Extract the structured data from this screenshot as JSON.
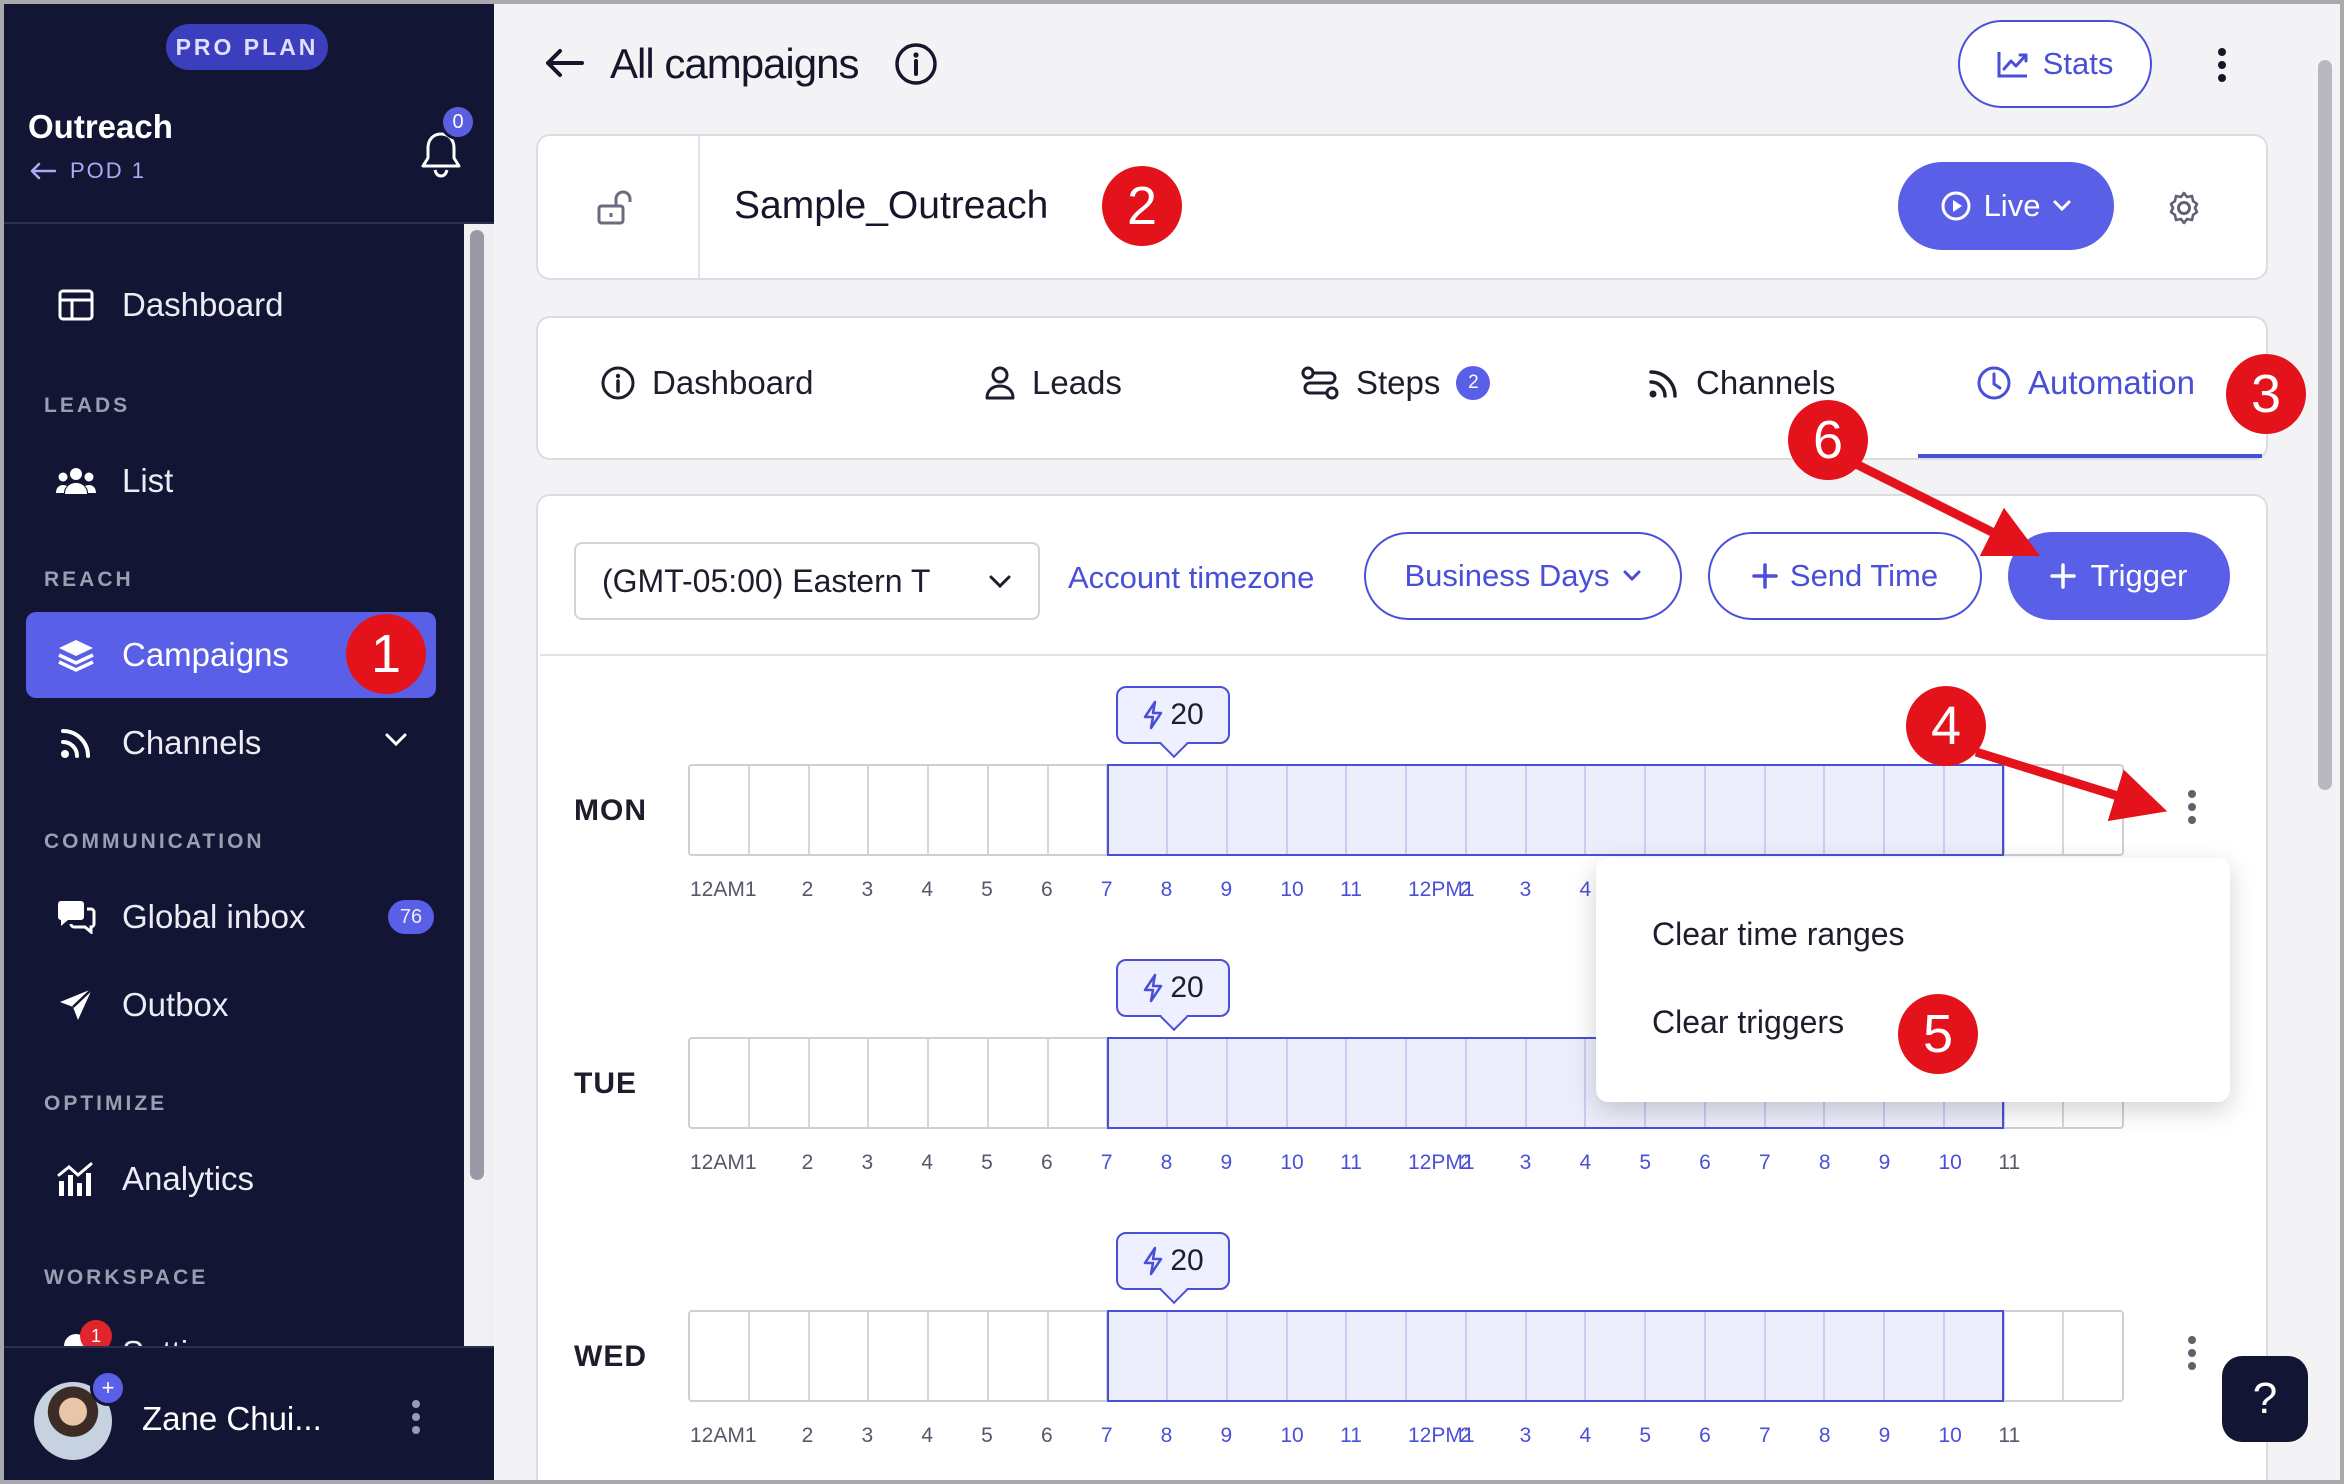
{
  "sidebar": {
    "plan_badge": "PRO PLAN",
    "app_name": "Outreach",
    "pod_label": "POD 1",
    "notification_count": "0",
    "sections": {
      "leads": "LEADS",
      "reach": "REACH",
      "communication": "COMMUNICATION",
      "optimize": "OPTIMIZE",
      "workspace": "WORKSPACE"
    },
    "items": {
      "dashboard": "Dashboard",
      "list": "List",
      "campaigns": "Campaigns",
      "channels": "Channels",
      "global_inbox": "Global inbox",
      "global_inbox_count": "76",
      "outbox": "Outbox",
      "analytics": "Analytics",
      "settings": "Settings",
      "settings_alert": "1"
    },
    "user_name": "Zane Chui...",
    "icons": [
      "dashboard-icon",
      "users-icon",
      "layers-icon",
      "rss-icon",
      "chat-icon",
      "send-icon",
      "analytics-icon",
      "gear-icon"
    ]
  },
  "header": {
    "title": "All campaigns",
    "stats_label": "Stats"
  },
  "campaign": {
    "name": "Sample_Outreach",
    "status_label": "Live"
  },
  "tabs": [
    {
      "label": "Dashboard"
    },
    {
      "label": "Leads"
    },
    {
      "label": "Steps",
      "badge": "2"
    },
    {
      "label": "Channels"
    },
    {
      "label": "Automation",
      "active": true
    }
  ],
  "toolbar": {
    "timezone_value": "(GMT-05:00) Eastern T",
    "account_timezone_link": "Account timezone",
    "business_days_label": "Business Days",
    "send_time_label": "Send Time",
    "trigger_label": "Trigger"
  },
  "schedule": {
    "tick_labels": [
      "12AM1",
      "2",
      "3",
      "4",
      "5",
      "6",
      "7",
      "8",
      "9",
      "10",
      "11",
      "12PM1",
      "2",
      "3",
      "4",
      "5",
      "6",
      "7",
      "8",
      "9",
      "10",
      "11"
    ],
    "active_hours": {
      "start": 7,
      "end": 22
    },
    "days": [
      {
        "label": "MON",
        "trigger_count": "20"
      },
      {
        "label": "TUE",
        "trigger_count": "20"
      },
      {
        "label": "WED",
        "trigger_count": "20"
      }
    ]
  },
  "menu": {
    "items": [
      "Clear time ranges",
      "Clear triggers"
    ]
  },
  "help_label": "?",
  "annotations": [
    "1",
    "2",
    "3",
    "4",
    "5",
    "6"
  ],
  "colors": {
    "sidebar_bg": "#121533",
    "accent": "#5a5fe8",
    "accent_text": "#4a4fd8",
    "annotation_red": "#e3121b",
    "selected_range_bg": "#ecedfb"
  }
}
